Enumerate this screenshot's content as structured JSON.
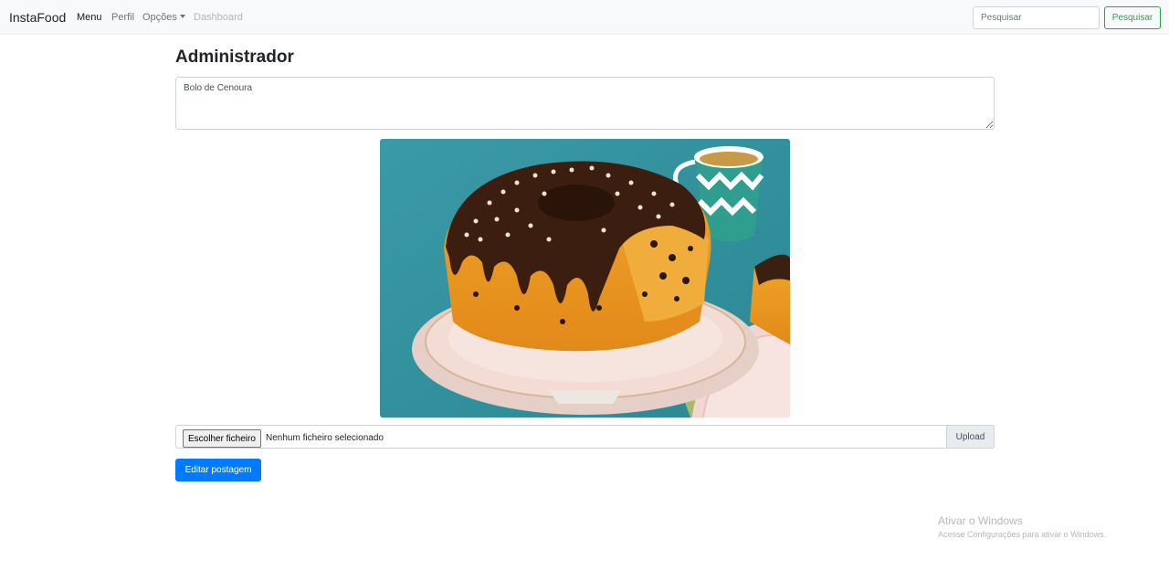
{
  "navbar": {
    "brand": "InstaFood",
    "links": [
      {
        "label": "Menu"
      },
      {
        "label": "Perfil"
      },
      {
        "label": "Opções"
      },
      {
        "label": "Dashboard"
      }
    ],
    "search_placeholder": "Pesquisar",
    "search_button": "Pesquisar"
  },
  "main": {
    "title": "Administrador",
    "post_text": "Bolo de Cenoura",
    "file_button": "Escolher ficheiro",
    "file_status": "Nenhum ficheiro selecionado",
    "upload_label": "Upload",
    "edit_button": "Editar postagem"
  },
  "watermark": {
    "title": "Ativar o Windows",
    "subtitle": "Acesse Configurações para ativar o Windows."
  },
  "colors": {
    "primary": "#007bff",
    "success": "#28a745",
    "navbar_bg": "#f8f9fa"
  }
}
